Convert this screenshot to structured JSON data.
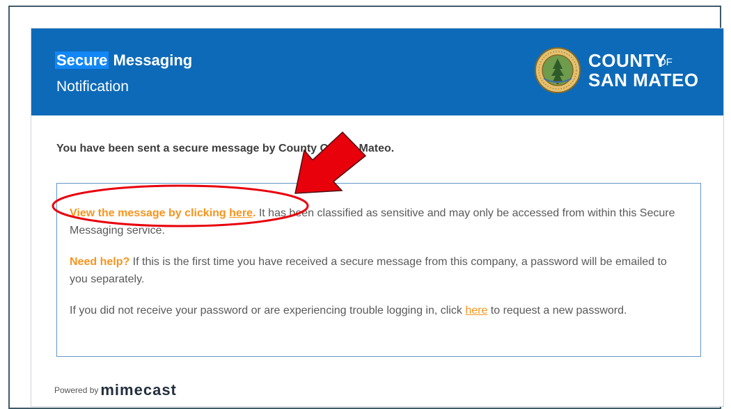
{
  "header": {
    "title_highlight": "Secure",
    "title_rest": "Messaging",
    "subtitle": "Notification",
    "logo": {
      "county": "COUNTY",
      "of": "OF",
      "place": "SAN MATEO",
      "seal_icon": "county-seal-icon"
    },
    "header_color": "#0d6ab8"
  },
  "body": {
    "intro": "You have been sent a secure message by County Of San Mateo.",
    "para1": {
      "lead": "View the message by clicking ",
      "link": "here",
      "lead_end": ".",
      "rest": " It has been classified as sensitive and may only be accessed from within this Secure Messaging service."
    },
    "para2": {
      "lead": "Need help?",
      "rest": " If this is the first time you have received a secure message from this company, a password will be emailed to you separately."
    },
    "para3": {
      "before": "If you did not receive your password or are experiencing trouble logging in, click ",
      "link": "here",
      "after": " to request a new password."
    }
  },
  "footer": {
    "powered": "Powered by",
    "brand": "mimecast"
  },
  "annotation": {
    "arrow_icon": "red-arrow-icon",
    "ellipse_icon": "red-ellipse-highlight",
    "color": "#e8000b"
  },
  "colors": {
    "accent": "#f7941d",
    "box_border": "#5f97c9"
  }
}
